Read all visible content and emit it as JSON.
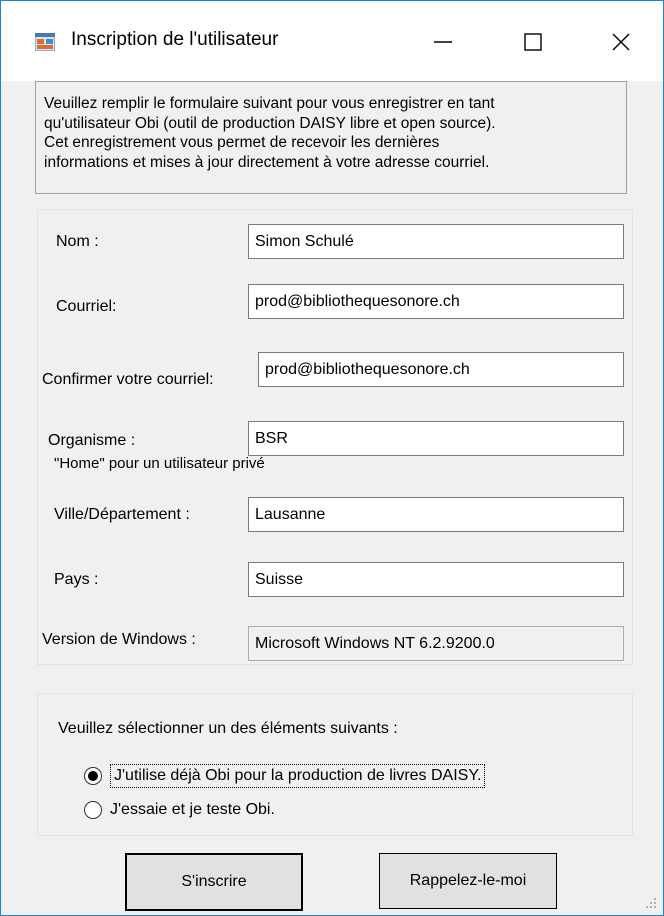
{
  "window": {
    "title": "Inscription de l'utilisateur"
  },
  "intro": {
    "line1": "Veuillez remplir le formulaire suivant pour vous enregistrer en tant",
    "line2": "qu'utilisateur Obi (outil de production DAISY libre et open source).",
    "line3": "Cet enregistrement vous permet de recevoir les dernières",
    "line4": "informations et mises à jour directement à votre adresse courriel."
  },
  "form": {
    "name_label": "Nom :",
    "name_value": "Simon Schulé",
    "email_label": "Courriel:",
    "email_value": "prod@bibliothequesonore.ch",
    "confirm_label": "Confirmer votre courriel:",
    "confirm_value": "prod@bibliothequesonore.ch",
    "org_label": "Organisme :",
    "org_value": "BSR",
    "org_hint": "\"Home\" pour un utilisateur privé",
    "city_label": "Ville/Département :",
    "city_value": "Lausanne",
    "country_label": "Pays :",
    "country_value": "Suisse",
    "windows_label": "Version de Windows :",
    "windows_value": "Microsoft Windows NT 6.2.9200.0"
  },
  "usage": {
    "prompt": "Veuillez sélectionner un des éléments suivants :",
    "option1": "J'utilise déjà Obi pour la production de livres DAISY.",
    "option2": "J'essaie et je teste Obi.",
    "selected": 1
  },
  "buttons": {
    "register": "S'inscrire",
    "remind": "Rappelez-le-moi"
  },
  "colors": {
    "accent": "#1883d7",
    "dialog_bg": "#f0f0f0"
  }
}
